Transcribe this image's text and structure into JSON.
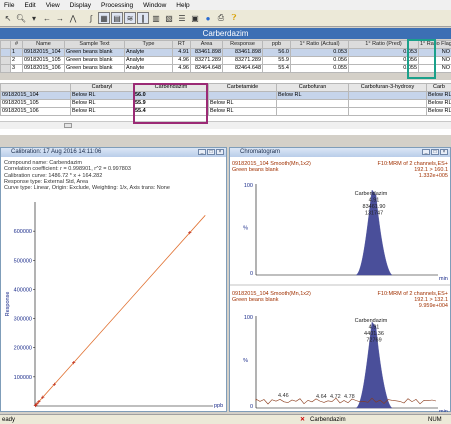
{
  "menu": [
    "File",
    "Edit",
    "View",
    "Display",
    "Processing",
    "Window",
    "Help"
  ],
  "toolbar_icons": [
    "select-icon",
    "zoom-icon",
    "dropdown-icon",
    "back-icon",
    "forward-icon",
    "peak-icon",
    "integrate-icon",
    "grid-icon",
    "layout-icon",
    "chromatogram-icon",
    "spectrum-icon",
    "table-icon",
    "overlay-icon",
    "stack-icon",
    "window-icon",
    "color-icon",
    "print-icon",
    "help-icon"
  ],
  "compound_title": "Carberdazim",
  "table1": {
    "headers": [
      "#",
      "Name",
      "Sample Text",
      "Type",
      "RT",
      "Area",
      "Response",
      "ppb",
      "1° Ratio (Actual)",
      "1° Ratio (Pred)",
      "1° Ratio Flag"
    ],
    "rows": [
      [
        "1",
        "09182015_104",
        "Green beans blank",
        "Analyte",
        "4.91",
        "83461.898",
        "83461.898",
        "56.0",
        "0.053",
        "0.053",
        "NO"
      ],
      [
        "2",
        "09182015_105",
        "Green beans blank",
        "Analyte",
        "4.96",
        "83271.289",
        "83271.289",
        "55.9",
        "0.056",
        "0.056",
        "NO"
      ],
      [
        "3",
        "09182015_106",
        "Green beans blank",
        "Analyte",
        "4.96",
        "82464.648",
        "82464.648",
        "55.4",
        "0.055",
        "0.055",
        "NO"
      ]
    ]
  },
  "table2": {
    "headers": [
      "",
      "Carbaryl",
      "Carbendazim",
      "Carbetamide",
      "Carbofuran",
      "Carbofuran-3-hydroxy",
      "Carb"
    ],
    "rows": [
      [
        "09182015_104",
        "Below RL",
        "56.0",
        "",
        "Below RL",
        "",
        "Below RL"
      ],
      [
        "09182015_105",
        "Below RL",
        "55.9",
        "Below RL",
        "",
        "",
        "Below RL"
      ],
      [
        "09182015_106",
        "Below RL",
        "55.4",
        "Below RL",
        "",
        "",
        "Below RL"
      ]
    ]
  },
  "calibration": {
    "title": "Calibration: 17 Aug 2016 14:11:06",
    "info": [
      "Compound name: Carbendazim",
      "Correlation coefficient: r = 0.998901, r^2 = 0.997803",
      "Calibration curve: 1486.72 * x + 164.282",
      "Response type: External Std, Area",
      "Curve type: Linear, Origin: Exclude, Weighting: 1/x, Axis trans: None"
    ],
    "ylabel": "Response",
    "xunit": "ppb"
  },
  "chromatogram": {
    "title": "Chromatogram",
    "unit": "min",
    "traces": [
      {
        "header_left": [
          "09182015_104 Smooth(Mn,1x2)",
          "Green beans blank"
        ],
        "header_right": [
          "F10:MRM of 2 channels,ES+",
          "192.1 > 160.1",
          "1.332e+005"
        ],
        "peak_labels": [
          "Carbendazim",
          "4.91",
          "83461.90",
          "131747"
        ],
        "yticks": [
          "100",
          "%",
          "0"
        ]
      },
      {
        "header_left": [
          "09182015_104 Smooth(Mn,1x2)",
          "Green beans blank"
        ],
        "header_right": [
          "F10:MRM of 2 channels,ES+",
          "192.1 > 132.1",
          "9.959e+004"
        ],
        "peak_labels": [
          "Carbendazim",
          "4.91",
          "4401.36",
          "72769"
        ],
        "other_peaks": [
          "4.46",
          "4.64",
          "4.72",
          "4.78"
        ],
        "yticks": [
          "100",
          "%",
          "0"
        ]
      }
    ]
  },
  "chart_data": {
    "type": "scatter",
    "title": "Calibration: 17 Aug 2016 14:11:06",
    "xlabel": "ppb",
    "ylabel": "Response",
    "ylim": [
      0,
      700000
    ],
    "yticks": [
      100000,
      200000,
      300000,
      400000,
      500000,
      600000
    ],
    "xlim": [
      0,
      460
    ],
    "series": [
      {
        "x": [
          1,
          2,
          5,
          10,
          20,
          50,
          100,
          400
        ],
        "y": [
          1650,
          3140,
          7600,
          15000,
          29900,
          74500,
          148800,
          594800
        ]
      }
    ],
    "fit_line": {
      "slope": 1486.72,
      "intercept": 164.282
    }
  },
  "status": {
    "left": "eady",
    "compound": "Carbendazim",
    "num": "NUM"
  },
  "colors": {
    "title_bar": "#3c6fb4",
    "ratio_highlight": "#1aa08a",
    "carb_highlight": "#9b2a75",
    "peak_fill": "#4a4f9a",
    "trace": "#8a3a1a",
    "fit_line": "#e07030"
  }
}
